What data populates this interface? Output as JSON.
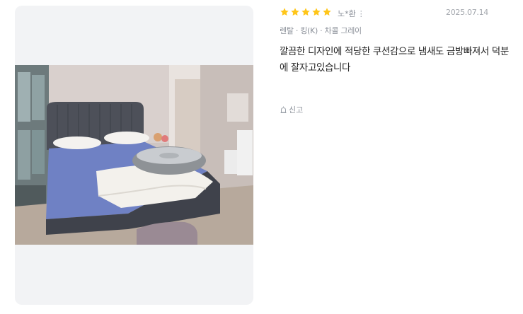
{
  "review": {
    "rating": 5,
    "rating_max": 5,
    "star_color": "#ffc61a",
    "author": "노*환",
    "more_icon": "⋮",
    "date": "2025.07.14",
    "option": "렌탈 · 킹(K) · 차콜 그레이",
    "text": "깔끔한 디자인에 적당한 쿠션감으로 냄새도 금방빠져서 덕분에 잘자고있습니다",
    "report_label": "신고"
  }
}
